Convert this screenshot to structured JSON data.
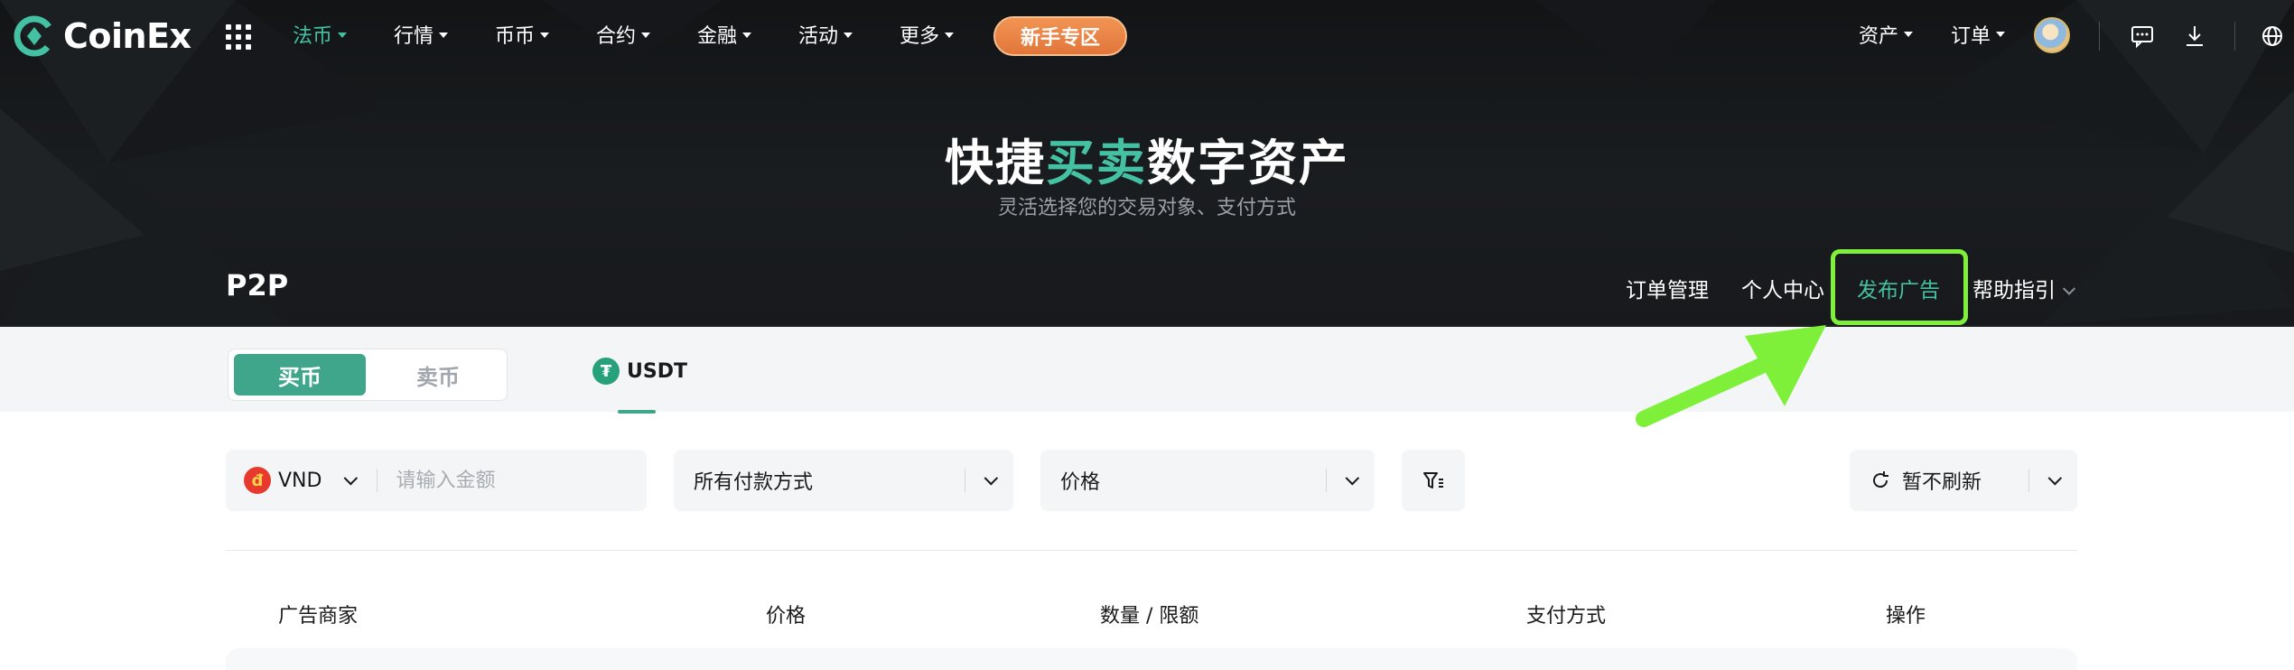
{
  "brand": {
    "name": "CoinEx"
  },
  "nav": {
    "menu": [
      {
        "label": "法币",
        "active": true
      },
      {
        "label": "行情",
        "active": false
      },
      {
        "label": "币币",
        "active": false
      },
      {
        "label": "合约",
        "active": false
      },
      {
        "label": "金融",
        "active": false
      },
      {
        "label": "活动",
        "active": false
      },
      {
        "label": "更多",
        "active": false
      }
    ],
    "newbie_button": "新手专区",
    "assets": "资产",
    "orders": "订单"
  },
  "hero": {
    "headline_pre": "快捷",
    "headline_accent": "买卖",
    "headline_post": "数字资产",
    "subtitle": "灵活选择您的交易对象、支付方式"
  },
  "p2p": {
    "title": "P2P",
    "links": [
      {
        "label": "订单管理",
        "active": false
      },
      {
        "label": "个人中心",
        "active": false
      },
      {
        "label": "发布广告",
        "active": true
      },
      {
        "label": "帮助指引",
        "active": false
      }
    ]
  },
  "tabs": {
    "buy": "买币",
    "sell": "卖币",
    "coin": "USDT",
    "coin_icon": "₮"
  },
  "filters": {
    "currency": "VND",
    "currency_icon": "đ",
    "amount_placeholder": "请输入金额",
    "payment": "所有付款方式",
    "sort": "价格",
    "refresh": "暂不刷新"
  },
  "table": {
    "columns": [
      "广告商家",
      "价格",
      "数量 / 限额",
      "支付方式",
      "操作"
    ]
  },
  "colors": {
    "accent": "#44c1a2",
    "buy": "#3fa68c",
    "highlight": "#7ef03a",
    "newbie": "#e2763a"
  }
}
